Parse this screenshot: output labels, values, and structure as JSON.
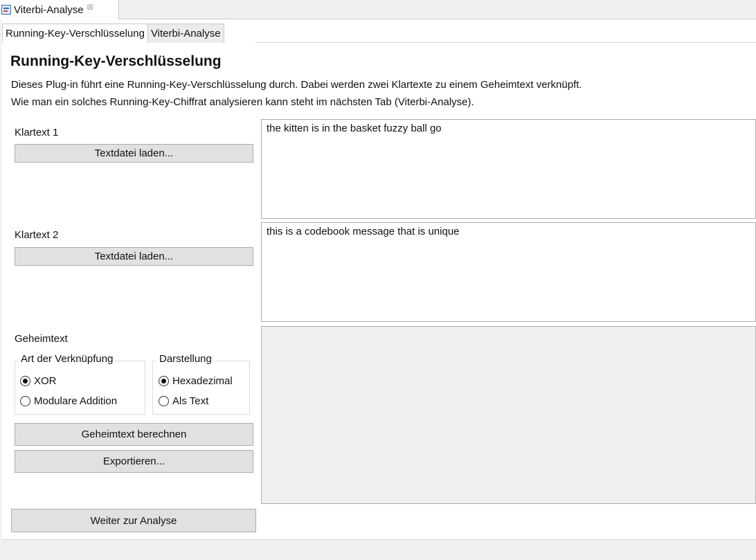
{
  "view": {
    "tab_title": "Viterbi-Analyse",
    "close_glyph": "☒"
  },
  "tabs": [
    {
      "label": "Running-Key-Verschlüsselung",
      "active": true
    },
    {
      "label": "Viterbi-Analyse",
      "active": false
    }
  ],
  "page": {
    "title": "Running-Key-Verschlüsselung",
    "description_line1": "Dieses Plug-in führt eine Running-Key-Verschlüsselung durch. Dabei werden zwei Klartexte zu einem Geheimtext verknüpft.",
    "description_line2": "Wie man ein solches Running-Key-Chiffrat analysieren kann steht im nächsten Tab (Viterbi-Analyse)."
  },
  "plaintext1": {
    "label": "Klartext 1",
    "load_button": "Textdatei laden...",
    "value": "the kitten is in the basket fuzzy ball go"
  },
  "plaintext2": {
    "label": "Klartext 2",
    "load_button": "Textdatei laden...",
    "value": "this is a codebook message that is unique"
  },
  "ciphertext": {
    "label": "Geheimtext",
    "value": "",
    "combination_group": {
      "legend": "Art der Verknüpfung",
      "options": [
        {
          "label": "XOR",
          "checked": true
        },
        {
          "label": "Modulare Addition",
          "checked": false
        }
      ]
    },
    "display_group": {
      "legend": "Darstellung",
      "options": [
        {
          "label": "Hexadezimal",
          "checked": true
        },
        {
          "label": "Als Text",
          "checked": false
        }
      ]
    },
    "compute_button": "Geheimtext berechnen",
    "export_button": "Exportieren..."
  },
  "next_button": "Weiter zur Analyse"
}
